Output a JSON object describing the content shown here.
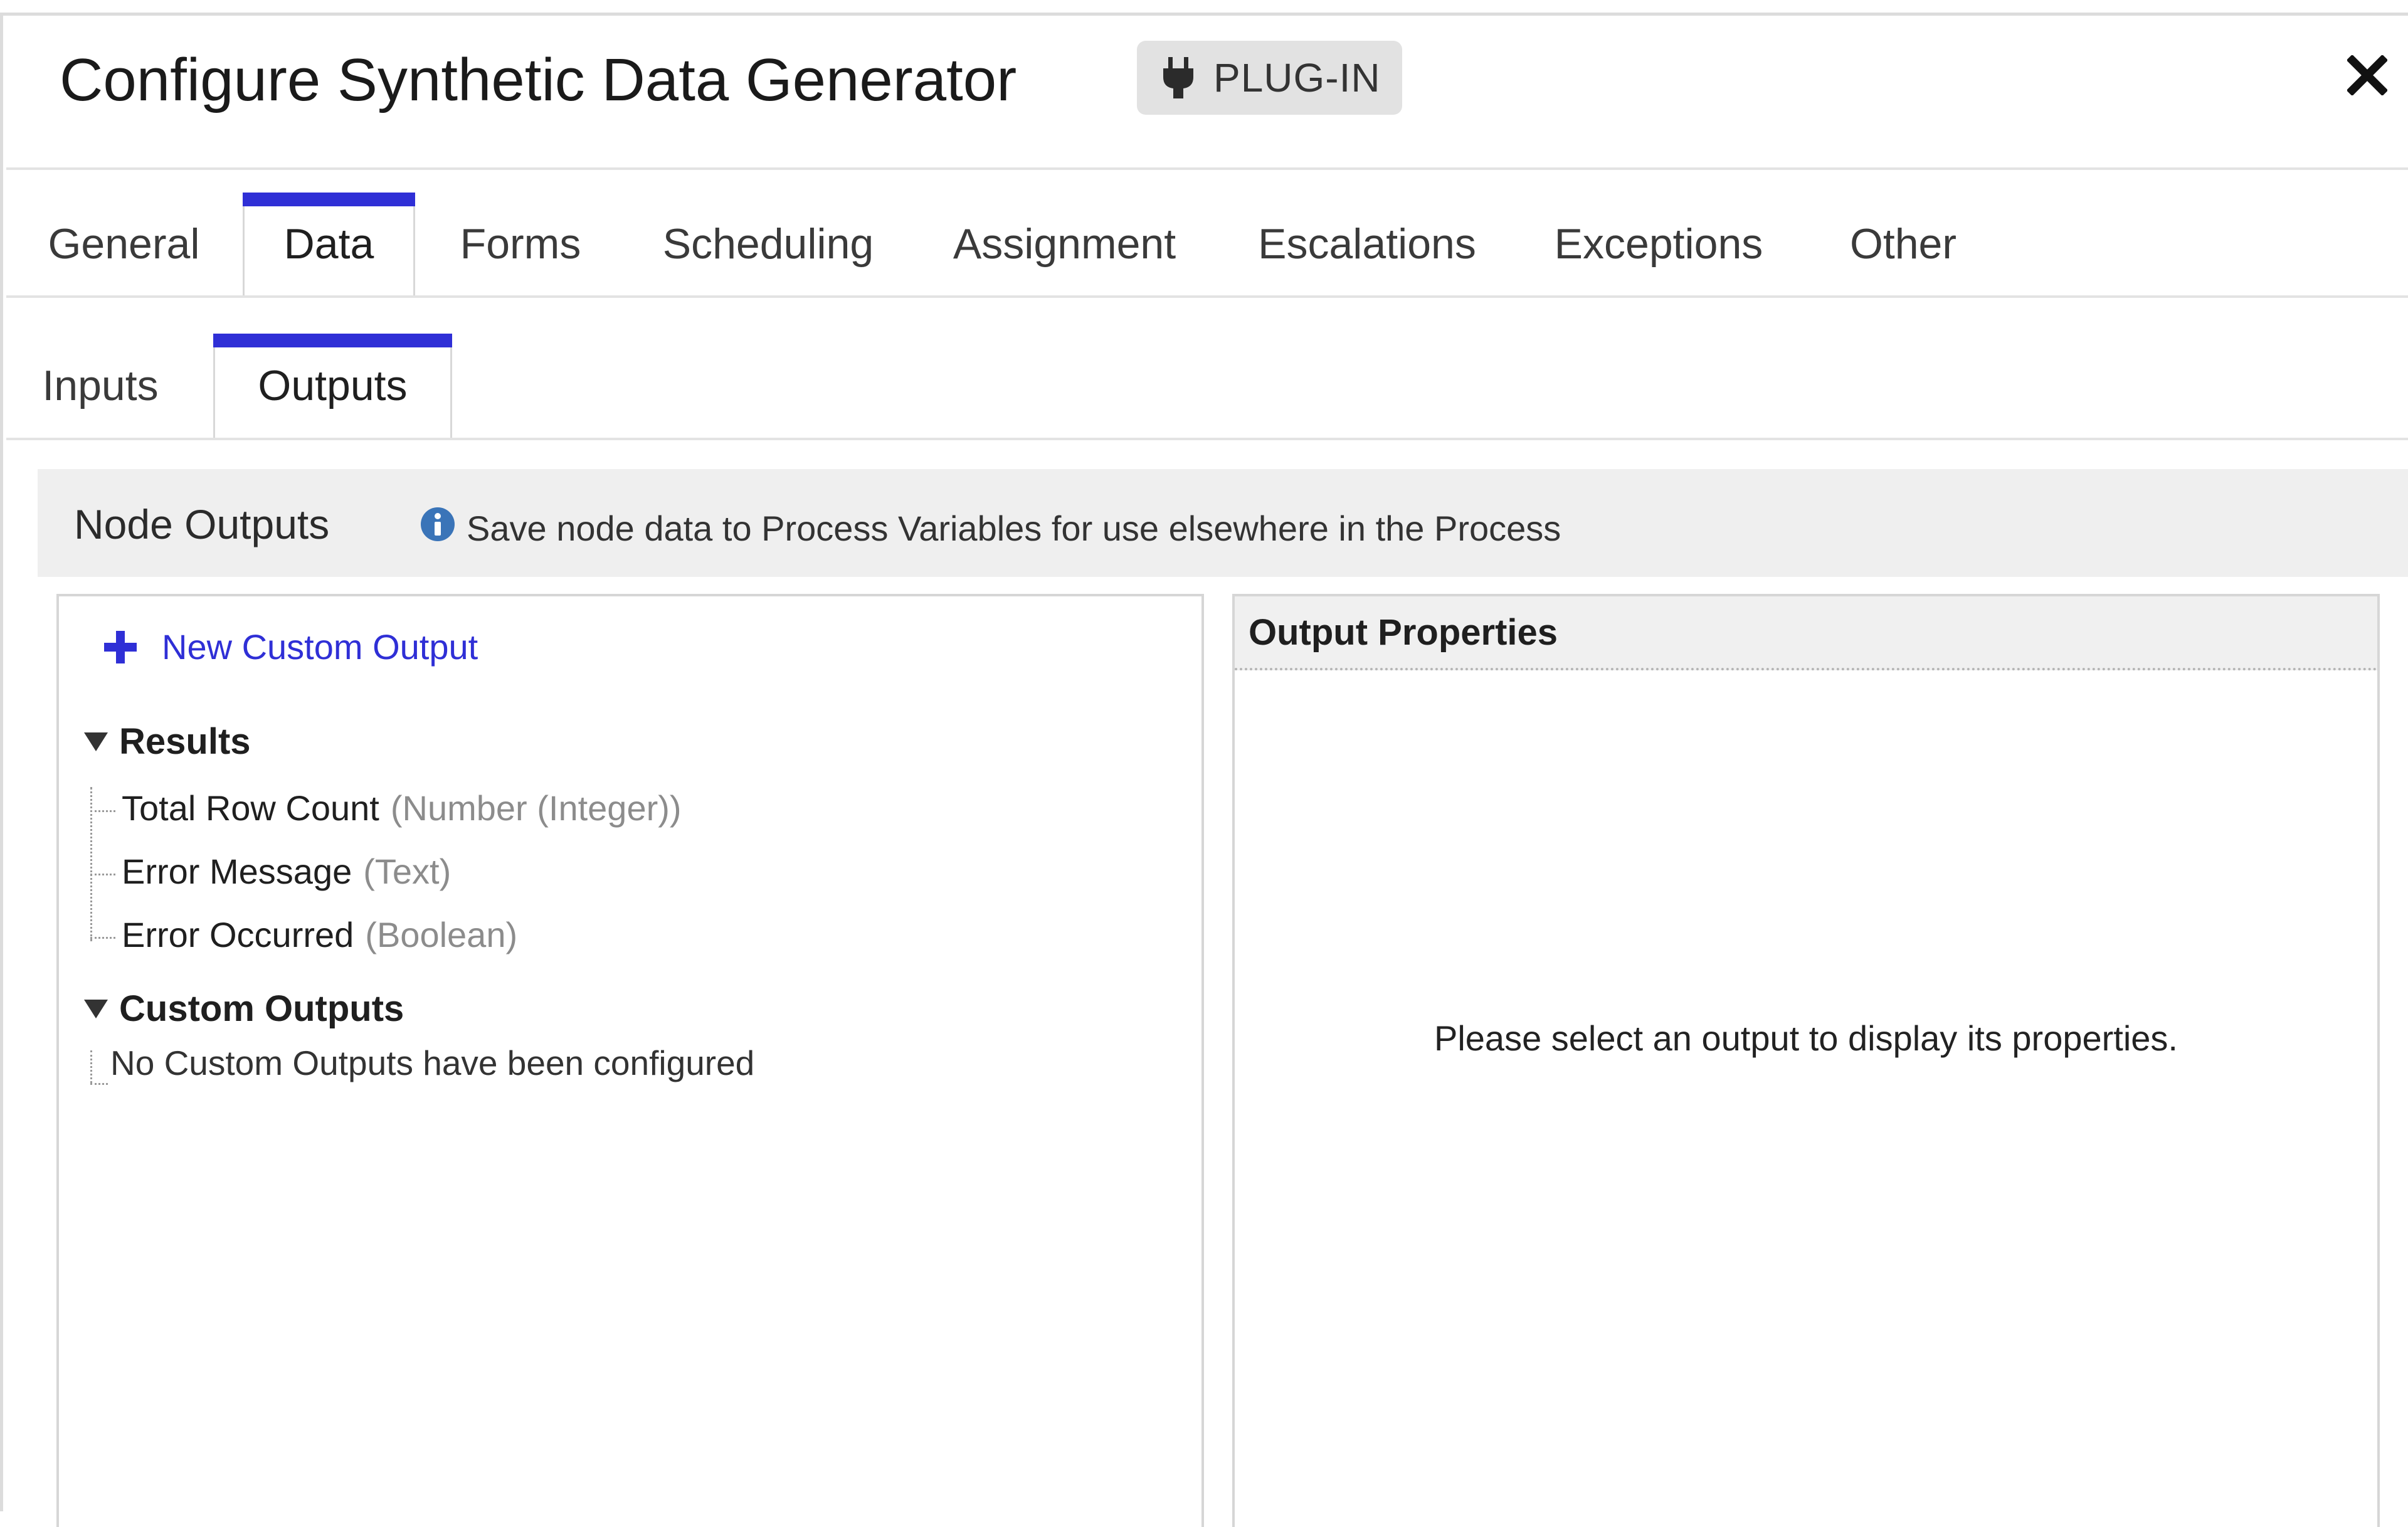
{
  "colors": {
    "accent": "#2f2fd6",
    "info": "#3a74b8"
  },
  "header": {
    "title": "Configure Synthetic Data Generator",
    "badge": "PLUG-IN",
    "badge_icon": "plug-icon",
    "close_icon": "close-icon"
  },
  "tabs": [
    {
      "label": "General"
    },
    {
      "label": "Data",
      "active": true
    },
    {
      "label": "Forms"
    },
    {
      "label": "Scheduling"
    },
    {
      "label": "Assignment"
    },
    {
      "label": "Escalations"
    },
    {
      "label": "Exceptions"
    },
    {
      "label": "Other"
    }
  ],
  "subtabs": [
    {
      "label": "Inputs"
    },
    {
      "label": "Outputs",
      "active": true
    }
  ],
  "section": {
    "title": "Node Outputs",
    "description": "Save node data to Process Variables for use elsewhere in the Process",
    "icon": "info-icon"
  },
  "left": {
    "new_output": "New Custom Output",
    "groups": [
      {
        "label": "Results",
        "items": [
          {
            "name": "Total Row Count",
            "type": "(Number (Integer))"
          },
          {
            "name": "Error Message",
            "type": "(Text)"
          },
          {
            "name": "Error Occurred",
            "type": "(Boolean)"
          }
        ]
      },
      {
        "label": "Custom Outputs",
        "empty": "No Custom Outputs have been configured"
      }
    ]
  },
  "right": {
    "title": "Output Properties",
    "placeholder": "Please select an output to display its properties."
  }
}
